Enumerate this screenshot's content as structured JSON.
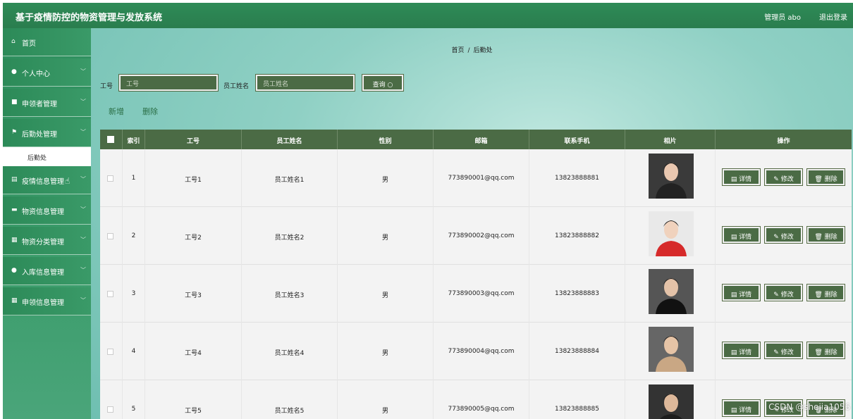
{
  "header": {
    "title": "基于疫情防控的物资管理与发放系统",
    "user": "管理员 abo",
    "logout": "退出登录"
  },
  "sidebar": {
    "items": [
      {
        "label": "首页",
        "icon": "home-icon",
        "glyph": "⌂"
      },
      {
        "label": "个人中心",
        "icon": "user-icon",
        "glyph": "●"
      },
      {
        "label": "申领者管理",
        "icon": "folder-icon",
        "glyph": "■"
      },
      {
        "label": "后勤处管理",
        "icon": "flag-icon",
        "glyph": "⚑"
      }
    ],
    "submenu": "后勤处",
    "items2": [
      {
        "label": "疫情信息管理",
        "icon": "document-icon",
        "glyph": "▤"
      },
      {
        "label": "物资信息管理",
        "icon": "box-icon",
        "glyph": "▬"
      },
      {
        "label": "物资分类管理",
        "icon": "grid-icon",
        "glyph": "▦"
      },
      {
        "label": "入库信息管理",
        "icon": "user-icon",
        "glyph": "●"
      },
      {
        "label": "申领信息管理",
        "icon": "grid-icon",
        "glyph": "▦"
      }
    ]
  },
  "breadcrumb": {
    "home": "首页",
    "current": "后勤处"
  },
  "search": {
    "field1_label": "工号",
    "field1_placeholder": "工号",
    "field2_label": "员工姓名",
    "field2_placeholder": "员工姓名",
    "button": "查询 ○"
  },
  "actions": {
    "add": "新增",
    "delete": "删除"
  },
  "table": {
    "headers": [
      "",
      "索引",
      "工号",
      "邮箱",
      "员工姓名",
      "性别",
      "邮箱",
      "联系手机",
      "相片",
      "操作"
    ],
    "h": {
      "index": "索引",
      "id": "工号",
      "name": "员工姓名",
      "gender": "性别",
      "email": "邮箱",
      "phone": "联系手机",
      "photo": "相片",
      "ops": "操作"
    },
    "ops": {
      "detail": "▤ 详情",
      "edit": "✎ 修改",
      "delete": "🗑 删除"
    },
    "rows": [
      {
        "index": "1",
        "id": "工号1",
        "name": "员工姓名1",
        "gender": "男",
        "email": "773890001@qq.com",
        "phone": "13823888881"
      },
      {
        "index": "2",
        "id": "工号2",
        "name": "员工姓名2",
        "gender": "男",
        "email": "773890002@qq.com",
        "phone": "13823888882"
      },
      {
        "index": "3",
        "id": "工号3",
        "name": "员工姓名3",
        "gender": "男",
        "email": "773890003@qq.com",
        "phone": "13823888883"
      },
      {
        "index": "4",
        "id": "工号4",
        "name": "员工姓名4",
        "gender": "男",
        "email": "773890004@qq.com",
        "phone": "13823888884"
      },
      {
        "index": "5",
        "id": "工号5",
        "name": "员工姓名5",
        "gender": "男",
        "email": "773890005@qq.com",
        "phone": "13823888885"
      }
    ]
  },
  "watermark": "CSDN @shejia1056",
  "colors": {
    "accent": "#2e8b57",
    "button": "#4b6b45"
  }
}
